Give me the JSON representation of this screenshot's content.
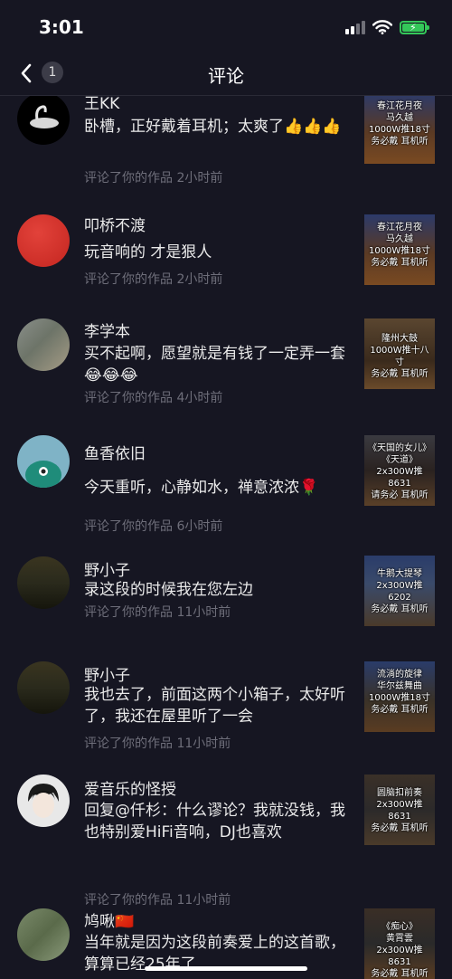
{
  "status": {
    "time": "3:01"
  },
  "nav": {
    "back_count": "1",
    "title": "评论"
  },
  "items": [
    {
      "name": "王KK",
      "text": "卧槽，正好戴着耳机；太爽了👍👍👍",
      "meta": "评论了你的作品  2小时前",
      "thumb": "春江花月夜\n马久越\n1000W推18寸\n务必戴  耳机听"
    },
    {
      "name": "叩桥不渡",
      "text": "玩音响的 才是狠人",
      "meta": "评论了你的作品  2小时前",
      "thumb": "春江花月夜\n马久越\n1000W推18寸\n务必戴  耳机听"
    },
    {
      "name": "李学本",
      "text": "买不起啊，愿望就是有钱了一定弄一套😂😂😂",
      "meta": "评论了你的作品  4小时前",
      "thumb": "隆州大鼓\n1000W推十八寸\n务必戴  耳机听"
    },
    {
      "name": "鱼香依旧",
      "text": "今天重听，心静如水，禅意浓浓🌹",
      "meta": "评论了你的作品  6小时前",
      "thumb": "《天国的女儿》\n《天道》\n2x300W推8631\n请务必  耳机听"
    },
    {
      "name": "野小子",
      "text": "录这段的时候我在您左边",
      "meta": "评论了你的作品  11小时前",
      "thumb": "牛鹅大提琴\n2x300W推6202\n务必戴  耳机听"
    },
    {
      "name": "野小子",
      "text": "我也去了，前面这两个小箱子，太好听了，我还在屋里听了一会",
      "meta": "评论了你的作品  11小时前",
      "thumb": "流淌的旋律\n华尔兹舞曲\n1000W推18寸\n务必戴  耳机听"
    },
    {
      "name": "爱音乐的怪授",
      "text": "回复@仟杉：什么谬论？我就没钱，我也特别爱HiFi音响，DJ也喜欢",
      "meta": "评论了你的作品  11小时前",
      "thumb": "圆脑扣前奏\n2x300W推8631\n务必戴  耳机听"
    },
    {
      "name": "鸠啾🇨🇳",
      "text": "当年就是因为这段前奏爱上的这首歌，算算已经25年了",
      "meta": "",
      "thumb": "《痴心》\n黄霄雲\n2x300W推8631\n务必戴  耳机听"
    }
  ],
  "colors": {
    "background": "#161622",
    "meta_gray": "#6e6e7a",
    "battery_green": "#34c759"
  }
}
